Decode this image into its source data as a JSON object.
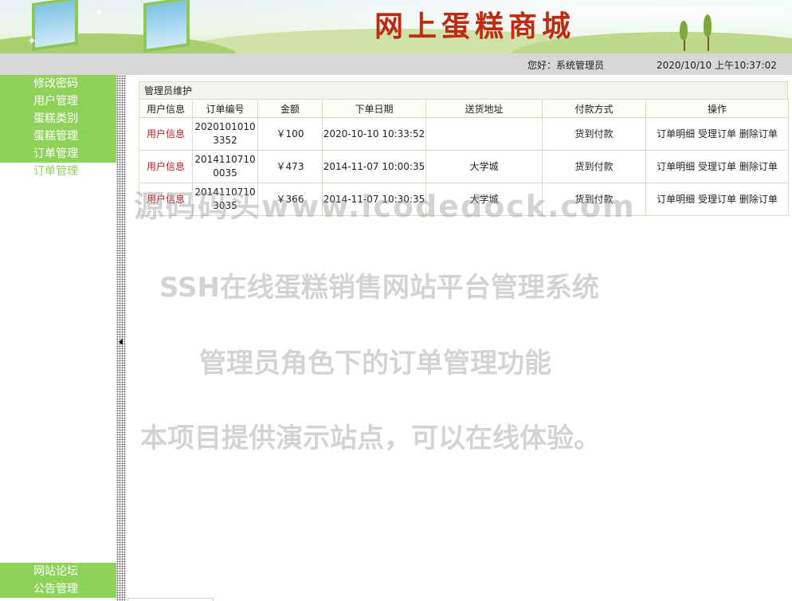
{
  "header": {
    "site_title": "网上蛋糕商城"
  },
  "infobar": {
    "greeting": "您好：系统管理员",
    "datetime": "2020/10/10 上午10:37:02"
  },
  "sidebar": {
    "items": [
      {
        "label": "修改密码"
      },
      {
        "label": "用户管理"
      },
      {
        "label": "蛋糕类别"
      },
      {
        "label": "蛋糕管理"
      },
      {
        "label": "订单管理"
      },
      {
        "label": "订单管理"
      }
    ],
    "bottom_items": [
      {
        "label": "网站论坛"
      },
      {
        "label": "公告管理"
      }
    ]
  },
  "panel": {
    "title": "管理员维护",
    "columns": [
      "用户信息",
      "订单编号",
      "金额",
      "下单日期",
      "送货地址",
      "付款方式",
      "操作"
    ],
    "rows": [
      {
        "user": "用户信息",
        "order_no_1": "2020101010",
        "order_no_2": "3352",
        "amount": "￥100",
        "date": "2020-10-10 10:33:52",
        "address": "",
        "payment": "货到付款",
        "op_detail": "订单明细",
        "op_accept": "受理订单",
        "op_delete": "删除订单"
      },
      {
        "user": "用户信息",
        "order_no_1": "2014110710",
        "order_no_2": "0035",
        "amount": "￥473",
        "date": "2014-11-07 10:00:35",
        "address": "大学城",
        "payment": "货到付款",
        "op_detail": "订单明细",
        "op_accept": "受理订单",
        "op_delete": "删除订单"
      },
      {
        "user": "用户信息",
        "order_no_1": "2014110710",
        "order_no_2": "3035",
        "amount": "￥366",
        "date": "2014-11-07 10:30:35",
        "address": "大学城",
        "payment": "货到付款",
        "op_detail": "订单明细",
        "op_accept": "受理订单",
        "op_delete": "删除订单"
      }
    ]
  },
  "watermarks": {
    "line1": "源码码头www.icodedock.com",
    "line2": "SSH在线蛋糕销售网站平台管理系统",
    "line3": "管理员角色下的订单管理功能",
    "line4": "本项目提供演示站点，可以在线体验。"
  }
}
